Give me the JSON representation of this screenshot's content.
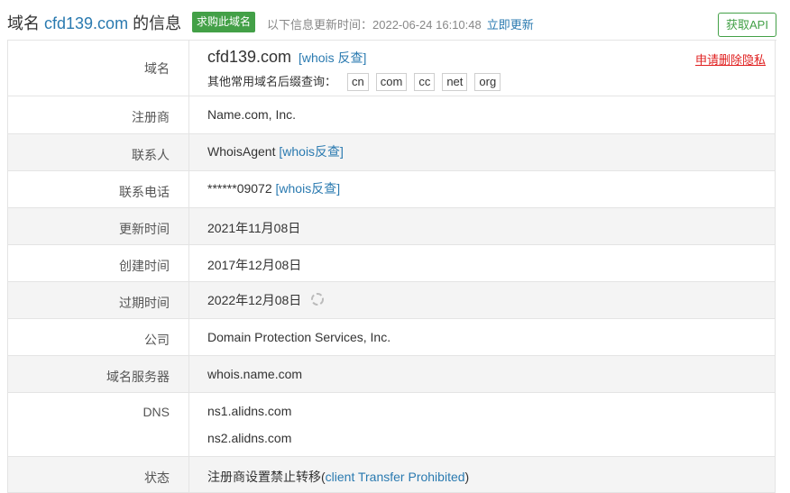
{
  "header": {
    "title_prefix": "域名",
    "domain": "cfd139.com",
    "title_suffix": "的信息",
    "buy_badge": "求购此域名",
    "update_label": "以下信息更新时间：",
    "update_time": "2022-06-24 16:10:48",
    "update_now": "立即更新",
    "api_button": "获取API"
  },
  "domain_row": {
    "label": "域名",
    "domain": "cfd139.com",
    "whois_link": "[whois 反查]",
    "privacy_link": "申请删除隐私",
    "suffix_label": "其他常用域名后缀查询：",
    "suffixes": [
      "cn",
      "com",
      "cc",
      "net",
      "org"
    ]
  },
  "rows": {
    "registrar": {
      "label": "注册商",
      "value": "Name.com, Inc."
    },
    "contact": {
      "label": "联系人",
      "value": "WhoisAgent",
      "link": "[whois反查]"
    },
    "phone": {
      "label": "联系电话",
      "value": "******09072",
      "link": "[whois反查]"
    },
    "updated": {
      "label": "更新时间",
      "value": "2021年11月08日"
    },
    "created": {
      "label": "创建时间",
      "value": "2017年12月08日"
    },
    "expires": {
      "label": "过期时间",
      "value": "2022年12月08日",
      "icon": "refresh-spinner-icon"
    },
    "company": {
      "label": "公司",
      "value": "Domain Protection Services, Inc."
    },
    "whois_server": {
      "label": "域名服务器",
      "value": "whois.name.com"
    },
    "dns": {
      "label": "DNS",
      "values": [
        "ns1.alidns.com",
        "ns2.alidns.com"
      ]
    },
    "status": {
      "label": "状态",
      "value_prefix": "注册商设置禁止转移(",
      "link": "client Transfer Prohibited",
      "value_suffix": ")"
    }
  },
  "colors": {
    "link": "#2a7ab0",
    "accent_green": "#43a047",
    "warn_red": "#e02020"
  }
}
